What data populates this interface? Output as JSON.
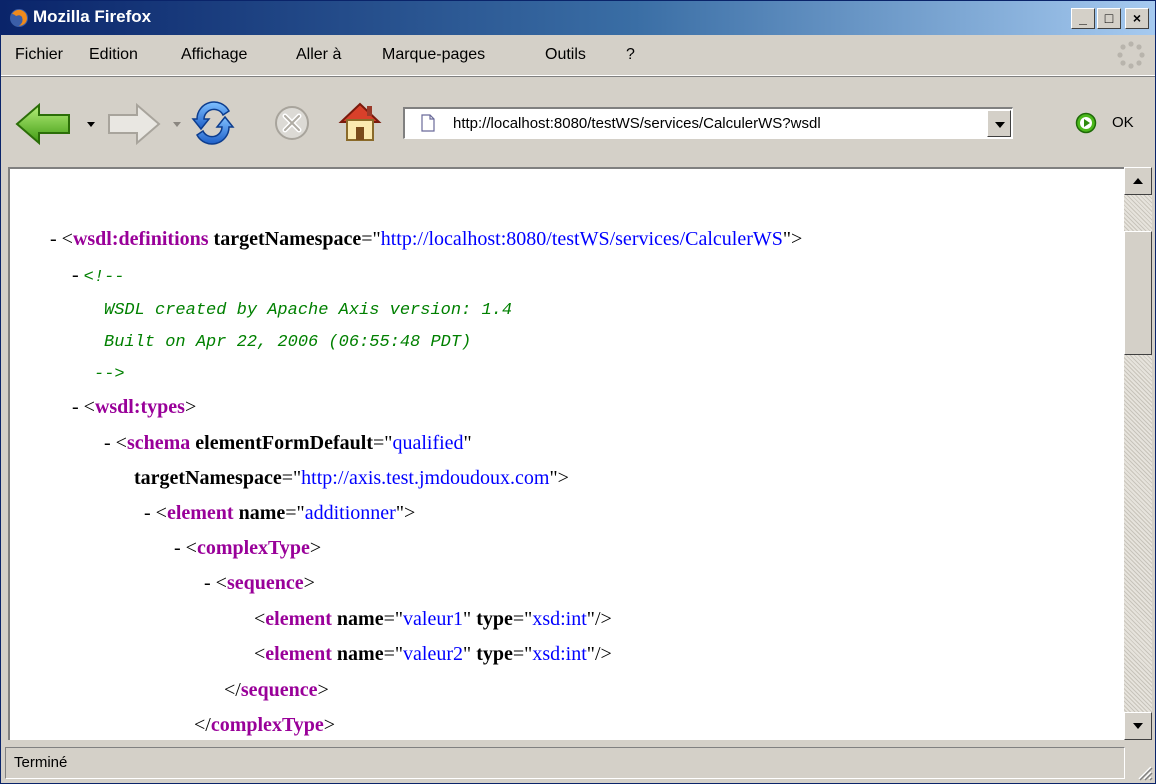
{
  "window": {
    "title": "Mozilla Firefox"
  },
  "title_buttons": {
    "minimize": "_",
    "maximize": "□",
    "close": "×"
  },
  "menu": [
    "Fichier",
    "Edition",
    "Affichage",
    "Aller à",
    "Marque-pages",
    "Outils",
    "?"
  ],
  "toolbar": {
    "back_icon": "back-arrow-icon",
    "forward_icon": "forward-arrow-icon",
    "reload_icon": "reload-icon",
    "stop_icon": "stop-icon",
    "home_icon": "home-icon",
    "url": "http://localhost:8080/testWS/services/CalculerWS?wsdl",
    "go_label": "OK"
  },
  "xml": {
    "l1": {
      "dash": "- <",
      "tag": "wsdl:definitions",
      "attr": " targetNamespace",
      "eq": "=\"",
      "val": "http://localhost:8080/testWS/services/CalculerWS",
      "end": "\">"
    },
    "l2": {
      "dash": "- ",
      "cm": "<!--"
    },
    "l3": {
      "cm": "WSDL created by Apache Axis version: 1.4"
    },
    "l4": {
      "cm": "Built on Apr 22, 2006 (06:55:48 PDT)"
    },
    "l5": {
      "cm": "-->"
    },
    "l6": {
      "dash": "- <",
      "tag": "wsdl:types",
      "end": ">"
    },
    "l7": {
      "dash": "- <",
      "tag": "schema",
      "attr": " elementFormDefault",
      "eq": "=\"",
      "val": "qualified",
      "end": "\""
    },
    "l8": {
      "attr": "targetNamespace",
      "eq": "=\"",
      "val": "http://axis.test.jmdoudoux.com",
      "end": "\">"
    },
    "l9": {
      "dash": "- <",
      "tag": "element",
      "attr": " name",
      "eq": "=\"",
      "val": "additionner",
      "end": "\">"
    },
    "l10": {
      "dash": "- <",
      "tag": "complexType",
      "end": ">"
    },
    "l11": {
      "dash": "- <",
      "tag": "sequence",
      "end": ">"
    },
    "l12": {
      "open": "<",
      "tag": "element",
      "attr1": " name",
      "eq1": "=\"",
      "val1": "valeur1",
      "q1": "\"",
      "attr2": " type",
      "eq2": "=\"",
      "val2": "xsd:int",
      "end": "\"/>"
    },
    "l13": {
      "open": "<",
      "tag": "element",
      "attr1": " name",
      "eq1": "=\"",
      "val1": "valeur2",
      "q1": "\"",
      "attr2": " type",
      "eq2": "=\"",
      "val2": "xsd:int",
      "end": "\"/>"
    },
    "l14": {
      "open": "</",
      "tag": "sequence",
      "end": ">"
    },
    "l15": {
      "open": "</",
      "tag": "complexType",
      "end": ">"
    }
  },
  "status": {
    "text": "Terminé"
  }
}
